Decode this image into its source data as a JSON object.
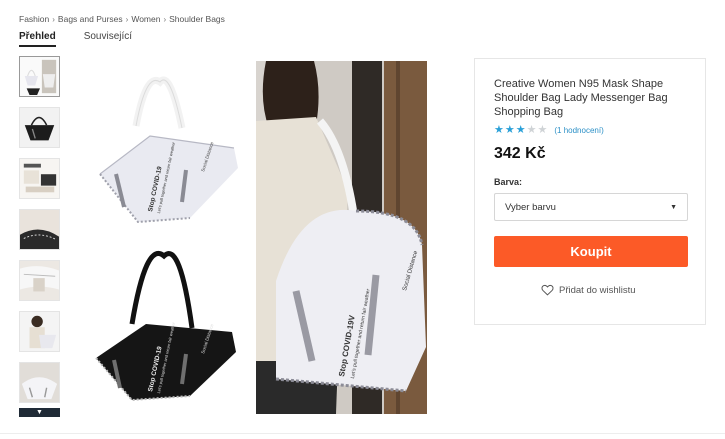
{
  "breadcrumb": [
    "Fashion",
    "Bags and Purses",
    "Women",
    "Shoulder Bags"
  ],
  "breadcrumb_separator": "›",
  "tabs": [
    {
      "label": "Přehled",
      "active": true
    },
    {
      "label": "Související",
      "active": false
    }
  ],
  "thumbnails": [
    {
      "icon": "bag-pair-thumbnail"
    },
    {
      "icon": "black-bag-thumbnail"
    },
    {
      "icon": "bag-detail-thumbnail"
    },
    {
      "icon": "bag-closeup-thumbnail"
    },
    {
      "icon": "bag-interior-thumbnail"
    },
    {
      "icon": "model-wearing-thumbnail"
    },
    {
      "icon": "bag-angle-thumbnail"
    }
  ],
  "thumb_more_icon": "▼",
  "images": {
    "main": {
      "bag_text_top": "Stop COVID-19",
      "bag_text_sub": "Let's pull together and return fair weather",
      "bag_text_side": "Social Distance"
    },
    "side": {
      "bag_text_top": "Stop COVID-19V",
      "bag_text_sub": "Let's pull together and return fair weather",
      "bag_text_side": "Social Distance"
    }
  },
  "product": {
    "title": "Creative Women N95 Mask Shape Shoulder Bag Lady Messenger Bag Shopping Bag",
    "rating": 3,
    "rating_max": 5,
    "rating_count": "(1 hodnocení)",
    "price": "342 Kč",
    "color_label": "Barva:",
    "color_select": "Vyber barvu",
    "buy_label": "Koupit",
    "wishlist_label": "Přidat do wishlistu"
  },
  "colors": {
    "accent": "#fc5a27",
    "star": "#2aa0d8",
    "link": "#2a8fc6"
  }
}
